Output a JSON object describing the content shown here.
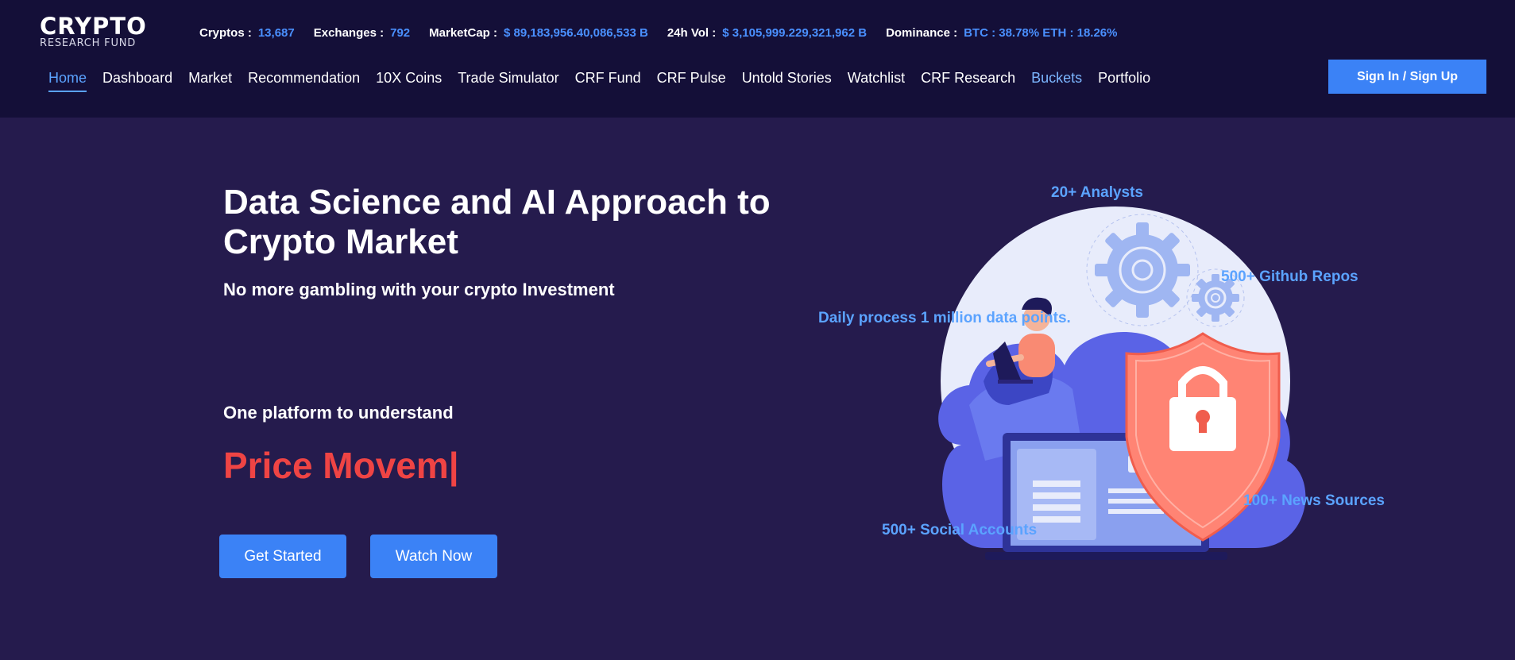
{
  "logo": {
    "main": "CRYPTO",
    "sub": "RESEARCH FUND"
  },
  "stats": [
    {
      "label": "Cryptos :",
      "value": "13,687"
    },
    {
      "label": "Exchanges :",
      "value": "792"
    },
    {
      "label": "MarketCap :",
      "value": "$ 89,183,956.40,086,533 B"
    },
    {
      "label": "24h Vol :",
      "value": "$ 3,105,999.229,321,962 B"
    },
    {
      "label": "Dominance :",
      "value": "BTC : 38.78% ETH : 18.26%"
    }
  ],
  "nav": {
    "items": [
      {
        "label": "Home"
      },
      {
        "label": "Dashboard"
      },
      {
        "label": "Market"
      },
      {
        "label": "Recommendation"
      },
      {
        "label": "10X Coins"
      },
      {
        "label": "Trade Simulator"
      },
      {
        "label": "CRF Fund"
      },
      {
        "label": "CRF Pulse"
      },
      {
        "label": "Untold Stories"
      },
      {
        "label": "Watchlist"
      },
      {
        "label": "CRF Research"
      },
      {
        "label": "Buckets"
      },
      {
        "label": "Portfolio"
      }
    ],
    "signin_label": "Sign In / Sign Up"
  },
  "hero": {
    "title": "Data Science and AI Approach to Crypto Market",
    "subtitle": "No more gambling with your crypto Investment",
    "lead": "One platform to understand",
    "typed_text": "Price Movem|",
    "get_started_label": "Get Started",
    "watch_now_label": "Watch Now"
  },
  "illustration": {
    "analysts": "20+ Analysts",
    "github": "500+ Github Repos",
    "data_points": "Daily process 1 million data points.",
    "news": "100+ News Sources",
    "social": "500+ Social Accounts"
  },
  "colors": {
    "background": "#251b4d",
    "header": "#140f38",
    "accent": "#3b82f6",
    "link_blue": "#5ba3ff",
    "typed_red": "#ef4444"
  }
}
